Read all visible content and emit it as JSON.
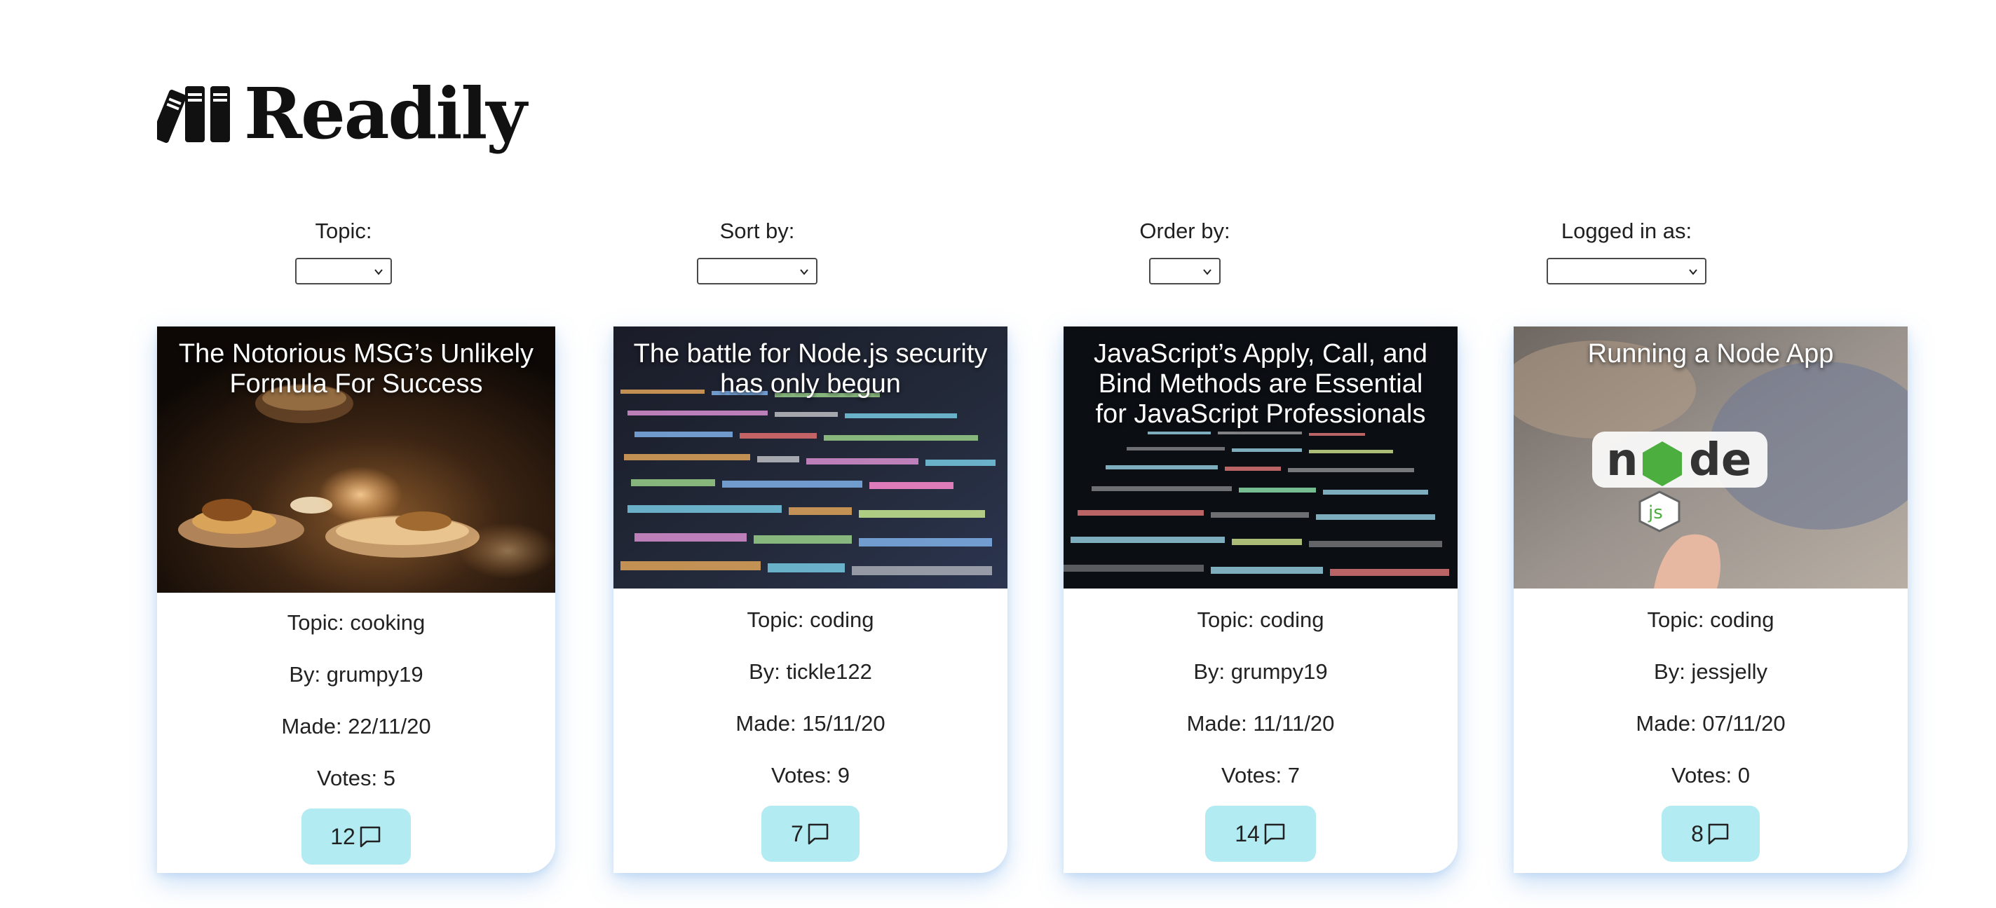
{
  "app": {
    "name": "Readily",
    "logo_icon": "books-icon"
  },
  "filters": [
    {
      "label": "Topic:",
      "selected": ""
    },
    {
      "label": "Sort by:",
      "selected": ""
    },
    {
      "label": "Order by:",
      "selected": ""
    },
    {
      "label": "Logged in as:",
      "selected": ""
    }
  ],
  "articles": [
    {
      "title": "The Notorious MSG’s Unlikely Formula For Success",
      "topic": "Topic: cooking",
      "author": "By: grumpy19",
      "made": "Made: 22/11/20",
      "votes": "Votes: 5",
      "comments": "12",
      "comment_icon": "comment-icon"
    },
    {
      "title": "The battle for Node.js security has only begun",
      "topic": "Topic: coding",
      "author": "By: tickle122",
      "made": "Made: 15/11/20",
      "votes": "Votes: 9",
      "comments": "7",
      "comment_icon": "comment-icon"
    },
    {
      "title": "JavaScript’s Apply, Call, and Bind Methods are Essential for JavaScript Professionals",
      "topic": "Topic: coding",
      "author": "By: grumpy19",
      "made": "Made: 11/11/20",
      "votes": "Votes: 7",
      "comments": "14",
      "comment_icon": "comment-icon"
    },
    {
      "title": "Running a Node App",
      "topic": "Topic: coding",
      "author": "By: jessjelly",
      "made": "Made: 07/11/20",
      "votes": "Votes: 0",
      "comments": "8",
      "comment_icon": "comment-icon"
    }
  ],
  "colors": {
    "comment_button": "#b2ebf2",
    "card_shadow": "#64a0e6"
  }
}
